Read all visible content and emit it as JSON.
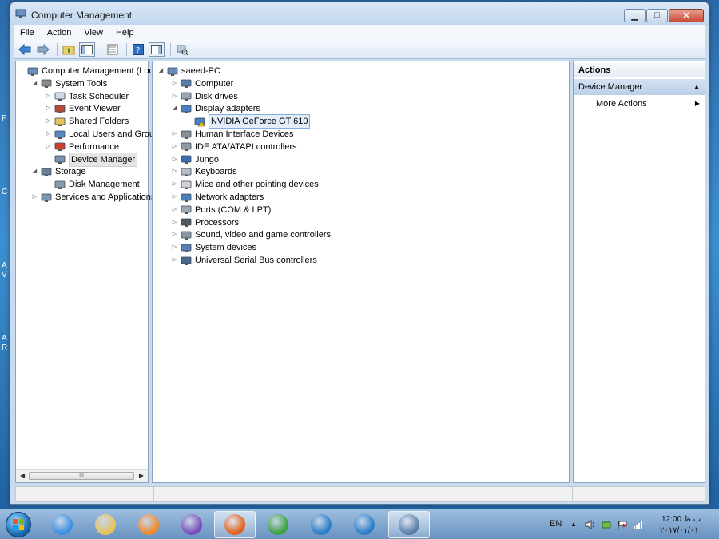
{
  "window": {
    "title": "Computer Management",
    "minimize_glyph": "▁",
    "maximize_glyph": "□",
    "close_glyph": "✕"
  },
  "menu": [
    "File",
    "Action",
    "View",
    "Help"
  ],
  "left_tree": [
    {
      "label": "Computer Management (Local",
      "depth": 0,
      "expander": "",
      "icon": "computer-management-icon"
    },
    {
      "label": "System Tools",
      "depth": 1,
      "expander": "◢",
      "icon": "tools-icon"
    },
    {
      "label": "Task Scheduler",
      "depth": 2,
      "expander": "▷",
      "icon": "clock-icon"
    },
    {
      "label": "Event Viewer",
      "depth": 2,
      "expander": "▷",
      "icon": "event-viewer-icon"
    },
    {
      "label": "Shared Folders",
      "depth": 2,
      "expander": "▷",
      "icon": "shared-folder-icon"
    },
    {
      "label": "Local Users and Groups",
      "depth": 2,
      "expander": "▷",
      "icon": "users-icon"
    },
    {
      "label": "Performance",
      "depth": 2,
      "expander": "▷",
      "icon": "performance-icon"
    },
    {
      "label": "Device Manager",
      "depth": 2,
      "expander": "",
      "icon": "device-manager-icon",
      "selected": true
    },
    {
      "label": "Storage",
      "depth": 1,
      "expander": "◢",
      "icon": "storage-icon"
    },
    {
      "label": "Disk Management",
      "depth": 2,
      "expander": "",
      "icon": "disk-icon"
    },
    {
      "label": "Services and Applications",
      "depth": 1,
      "expander": "▷",
      "icon": "services-icon"
    }
  ],
  "hscroll_thumb": "III",
  "device_tree": [
    {
      "label": "saeed-PC",
      "depth": 0,
      "expander": "◢",
      "icon": "pc-icon"
    },
    {
      "label": "Computer",
      "depth": 1,
      "expander": "▷",
      "icon": "computer-icon"
    },
    {
      "label": "Disk drives",
      "depth": 1,
      "expander": "▷",
      "icon": "disk-drive-icon"
    },
    {
      "label": "Display adapters",
      "depth": 1,
      "expander": "◢",
      "icon": "display-adapter-icon"
    },
    {
      "label": "NVIDIA GeForce GT 610",
      "depth": 2,
      "expander": "",
      "icon": "warning-display-icon",
      "selected": true
    },
    {
      "label": "Human Interface Devices",
      "depth": 1,
      "expander": "▷",
      "icon": "hid-icon"
    },
    {
      "label": "IDE ATA/ATAPI controllers",
      "depth": 1,
      "expander": "▷",
      "icon": "ide-icon"
    },
    {
      "label": "Jungo",
      "depth": 1,
      "expander": "▷",
      "icon": "jungo-icon"
    },
    {
      "label": "Keyboards",
      "depth": 1,
      "expander": "▷",
      "icon": "keyboard-icon"
    },
    {
      "label": "Mice and other pointing devices",
      "depth": 1,
      "expander": "▷",
      "icon": "mouse-icon"
    },
    {
      "label": "Network adapters",
      "depth": 1,
      "expander": "▷",
      "icon": "network-icon"
    },
    {
      "label": "Ports (COM & LPT)",
      "depth": 1,
      "expander": "▷",
      "icon": "port-icon"
    },
    {
      "label": "Processors",
      "depth": 1,
      "expander": "▷",
      "icon": "processor-icon"
    },
    {
      "label": "Sound, video and game controllers",
      "depth": 1,
      "expander": "▷",
      "icon": "sound-icon"
    },
    {
      "label": "System devices",
      "depth": 1,
      "expander": "▷",
      "icon": "system-device-icon"
    },
    {
      "label": "Universal Serial Bus controllers",
      "depth": 1,
      "expander": "▷",
      "icon": "usb-icon"
    }
  ],
  "actions": {
    "header": "Actions",
    "section": "Device Manager",
    "section_arrow": "▲",
    "item": "More Actions",
    "item_arrow": "▶"
  },
  "taskbar": {
    "apps": [
      {
        "name": "internet-explorer-icon",
        "color": "#3a8fe0"
      },
      {
        "name": "file-explorer-icon",
        "color": "#e8c35a"
      },
      {
        "name": "media-player-icon",
        "color": "#f08a2a"
      },
      {
        "name": "visual-studio-icon",
        "color": "#7a4bb8"
      },
      {
        "name": "firefox-icon",
        "color": "#e2601d",
        "active": true
      },
      {
        "name": "download-manager-icon",
        "color": "#3aa040"
      },
      {
        "name": "app-c-icon",
        "color": "#2a7cc8"
      },
      {
        "name": "app-c2-icon",
        "color": "#2a7cc8"
      },
      {
        "name": "computer-management-taskbar-icon",
        "color": "#5a7ea8",
        "active": true
      }
    ],
    "lang": "EN",
    "time": "12:00 ب.ظ",
    "date": "۲۰۱۷/۰۱/۰۱"
  },
  "desktop_glyphs": [
    "F",
    "C",
    "A",
    "V",
    "A",
    "R"
  ]
}
